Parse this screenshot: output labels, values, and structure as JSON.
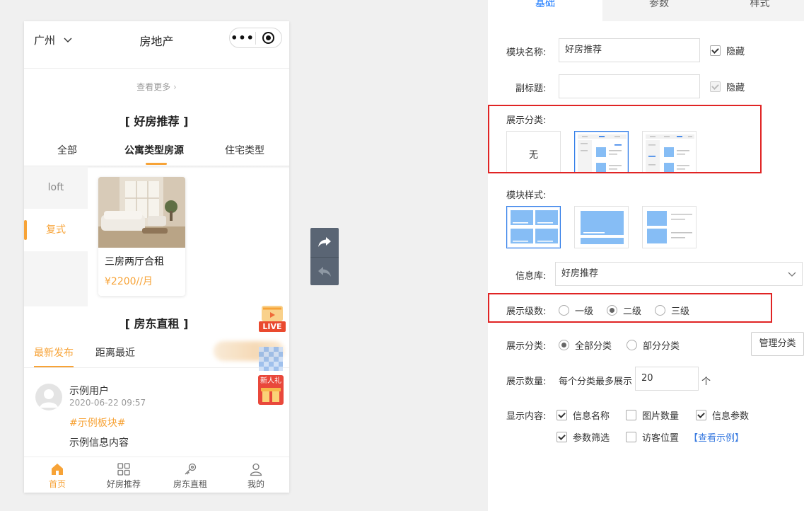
{
  "preview": {
    "header": {
      "city": "广州",
      "title": "房地产"
    },
    "view_more": "查看更多",
    "section1": {
      "title": "[ 好房推荐 ]",
      "tabs": [
        "全部",
        "公寓类型房源",
        "住宅类型"
      ],
      "active_tab": 1,
      "side_items": [
        "loft",
        "复式"
      ],
      "active_side": 1,
      "card": {
        "title": "三房两厅合租",
        "price": "¥2200//月"
      }
    },
    "section2": {
      "title": "[ 房东直租 ]",
      "tabs": [
        "最新发布",
        "距离最近"
      ],
      "active_tab": 0,
      "post": {
        "user": "示例用户",
        "time": "2020-06-22 09:57",
        "tag": "#示例板块#",
        "content": "示例信息内容"
      }
    },
    "floats": {
      "live": "LIVE",
      "gift": "新人礼"
    },
    "tabbar": [
      {
        "label": "首页",
        "icon": "home-icon",
        "active": true
      },
      {
        "label": "好房推荐",
        "icon": "grid-icon",
        "active": false
      },
      {
        "label": "房东直租",
        "icon": "key-icon",
        "active": false
      },
      {
        "label": "我的",
        "icon": "user-icon",
        "active": false
      }
    ]
  },
  "tools": {
    "redo_icon": "redo-icon",
    "undo_icon": "undo-icon"
  },
  "panel": {
    "tabs": [
      "基础",
      "参数",
      "样式"
    ],
    "active_tab": 0,
    "module_name": {
      "label": "模块名称:",
      "value": "好房推荐",
      "hide_label": "隐藏",
      "hidden": true
    },
    "subtitle": {
      "label": "副标题:",
      "value": "",
      "hide_label": "隐藏",
      "hidden": true
    },
    "display_category": {
      "label": "展示分类:",
      "none_label": "无",
      "selected": 1
    },
    "module_style": {
      "label": "模块样式:",
      "selected": 0
    },
    "library": {
      "label": "信息库:",
      "value": "好房推荐"
    },
    "levels": {
      "label": "展示级数:",
      "options": [
        "一级",
        "二级",
        "三级"
      ],
      "selected": 1
    },
    "category_scope": {
      "label": "展示分类:",
      "options": [
        "全部分类",
        "部分分类"
      ],
      "selected": 0,
      "manage_button": "管理分类"
    },
    "count": {
      "label": "展示数量:",
      "prefix": "每个分类最多展示",
      "value": "20",
      "unit": "个"
    },
    "content": {
      "label": "显示内容:",
      "options": [
        {
          "label": "信息名称",
          "checked": true
        },
        {
          "label": "图片数量",
          "checked": false
        },
        {
          "label": "信息参数",
          "checked": true
        },
        {
          "label": "参数筛选",
          "checked": true
        },
        {
          "label": "访客位置",
          "checked": false
        }
      ],
      "example_link": "【查看示例】"
    },
    "colors": {
      "accent": "#f7a337",
      "highlight": "#e02424",
      "primary": "#2f7ce8"
    }
  }
}
